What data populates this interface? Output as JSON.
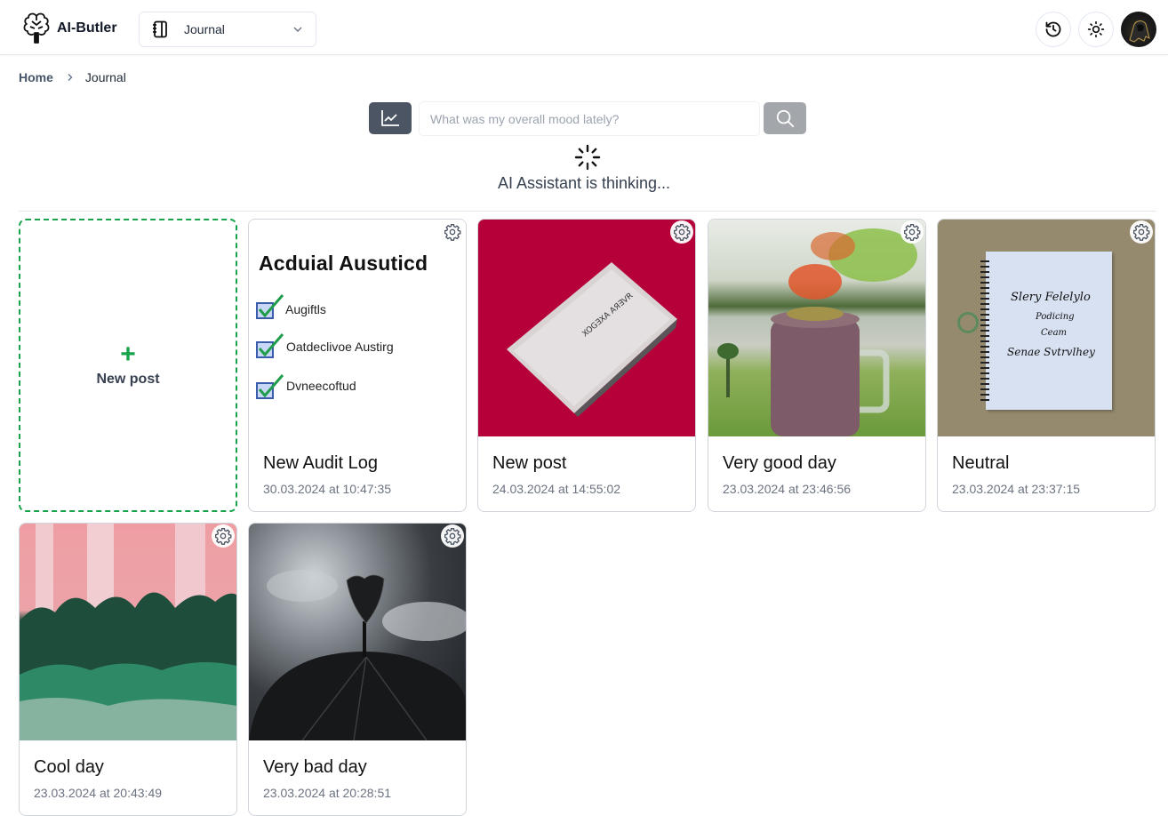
{
  "header": {
    "app_name": "AI-Butler",
    "journal_select": {
      "selected": "Journal"
    },
    "history_button": "history",
    "theme_button": "theme",
    "avatar_alt": "user avatar"
  },
  "breadcrumb": {
    "home": "Home",
    "current": "Journal"
  },
  "search": {
    "placeholder": "What was my overall mood lately?",
    "value": ""
  },
  "status": {
    "thinking": "AI Assistant is thinking..."
  },
  "new_post": {
    "label": "New post",
    "plus": "+"
  },
  "posts": [
    {
      "title": "New Audit Log",
      "date": "30.03.2024 at 10:47:35",
      "image": "audit-checklist"
    },
    {
      "title": "New post",
      "date": "24.03.2024 at 14:55:02",
      "image": "silver-laptop-on-red"
    },
    {
      "title": "Very good day",
      "date": "23.03.2024 at 23:46:56",
      "image": "smoothie-by-lake"
    },
    {
      "title": "Neutral",
      "date": "23.03.2024 at 23:37:15",
      "image": "spiral-notebook"
    },
    {
      "title": "Cool day",
      "date": "23.03.2024 at 20:43:49",
      "image": "pink-wall-green-leaves"
    },
    {
      "title": "Very bad day",
      "date": "23.03.2024 at 20:28:51",
      "image": "black-umbrella-storm"
    }
  ],
  "audit_image_text": {
    "heading": "Acduial Ausuticd",
    "items": [
      "Augiftls",
      "Oatdeclivoe Austirg",
      "Dvneecoftud"
    ]
  },
  "notebook_image_text": [
    "Slery Felelylo",
    "Podicing",
    "Ceam",
    "Senae Svtrvlhey"
  ],
  "colors": {
    "accent_green": "#16a34a",
    "button_dark": "#4b5563",
    "button_gray": "#a3a6ab"
  }
}
